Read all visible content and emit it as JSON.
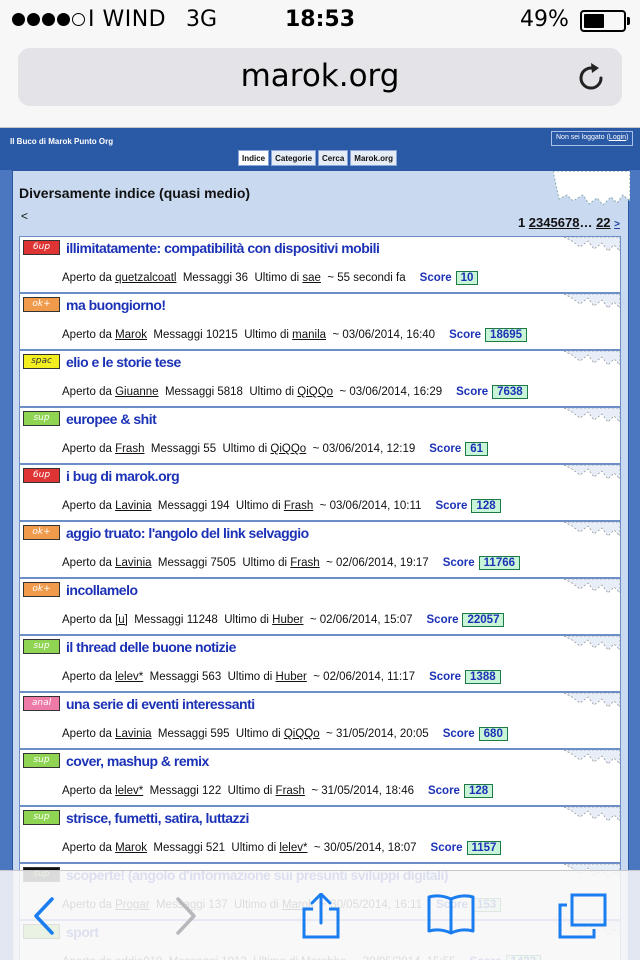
{
  "status": {
    "carrier": "I WIND",
    "network": "3G",
    "time": "18:53",
    "battery_pct": "49%",
    "battery_level": 0.49,
    "signal_bars_filled": 4,
    "signal_bars_total": 5
  },
  "browser": {
    "url": "marok.org"
  },
  "site": {
    "name": "Il Buco di Marok Punto Org",
    "login_prefix": "Non sei loggato (",
    "login_link": "Login",
    "login_suffix": ")",
    "tabs": [
      "Indice",
      "Categorie",
      "Cerca",
      "Marok.org"
    ]
  },
  "index": {
    "heading": "Diversamente indice (quasi medio)",
    "back": "<",
    "pager": {
      "current": "1",
      "pages": [
        "2",
        "3",
        "4",
        "5",
        "6",
        "7",
        "8"
      ],
      "ellipsis": "…",
      "last": "22",
      "next": ">"
    }
  },
  "labels": {
    "opened_by": "Aperto da",
    "messages": "Messaggi",
    "last_by": "Ultimo di",
    "score": "Score"
  },
  "threads": [
    {
      "badge": "6up",
      "badge_color": "red",
      "title": "illimitatamente: compatibilità con dispositivi mobili",
      "author": "quetzalcoatl",
      "messages": "36",
      "last_user": "sae",
      "when": "~ 55 secondi fa",
      "score": "10"
    },
    {
      "badge": "ok+",
      "badge_color": "orange",
      "title": "ma buongiorno!",
      "author": "Marok",
      "messages": "10215",
      "last_user": "manila",
      "when": "~ 03/06/2014, 16:40",
      "score": "18695"
    },
    {
      "badge": "spac",
      "badge_color": "yellow",
      "title": "elio e le storie tese",
      "author": "Giuanne",
      "messages": "5818",
      "last_user": "QiQQo",
      "when": "~ 03/06/2014, 16:29",
      "score": "7638"
    },
    {
      "badge": "sup",
      "badge_color": "green",
      "title": "europee & shit",
      "author": "Frash",
      "messages": "55",
      "last_user": "QiQQo",
      "when": "~ 03/06/2014, 12:19",
      "score": "61"
    },
    {
      "badge": "6up",
      "badge_color": "red",
      "title": "i bug di marok.org",
      "author": "Lavinia",
      "messages": "194",
      "last_user": "Frash",
      "when": "~ 03/06/2014, 10:11",
      "score": "128"
    },
    {
      "badge": "ok+",
      "badge_color": "orange",
      "title": "aggio truato: l'angolo del link selvaggio",
      "author": "Lavinia",
      "messages": "7505",
      "last_user": "Frash",
      "when": "~ 02/06/2014, 19:17",
      "score": "11766"
    },
    {
      "badge": "ok+",
      "badge_color": "orange",
      "title": "incollamelo",
      "author": "[u]",
      "messages": "11248",
      "last_user": "Huber",
      "when": "~ 02/06/2014, 15:07",
      "score": "22057"
    },
    {
      "badge": "sup",
      "badge_color": "green",
      "title": "il thread delle buone notizie",
      "author": "lelev*",
      "messages": "563",
      "last_user": "Huber",
      "when": "~ 02/06/2014, 11:17",
      "score": "1388"
    },
    {
      "badge": "anal",
      "badge_color": "pink",
      "title": "una serie di eventi interessanti",
      "author": "Lavinia",
      "messages": "595",
      "last_user": "QiQQo",
      "when": "~ 31/05/2014, 20:05",
      "score": "680"
    },
    {
      "badge": "sup",
      "badge_color": "green",
      "title": "cover, mashup & remix",
      "author": "lelev*",
      "messages": "122",
      "last_user": "Frash",
      "when": "~ 31/05/2014, 18:46",
      "score": "128"
    },
    {
      "badge": "sup",
      "badge_color": "green",
      "title": "strisce, fumetti, satira, luttazzi",
      "author": "Marok",
      "messages": "521",
      "last_user": "lelev*",
      "when": "~ 30/05/2014, 18:07",
      "score": "1157"
    },
    {
      "badge": "sup",
      "badge_color": "black",
      "title": "scoperte! (angolo d'informazione sui presunti sviluppi digitali)",
      "author": "Progar",
      "messages": "137",
      "last_user": "Marok",
      "when": "~ 30/05/2014, 16:11",
      "score": "153"
    },
    {
      "badge": "",
      "badge_color": "green",
      "title": "sport",
      "author": "eddie019",
      "messages": "1012",
      "last_user": "Marobbe",
      "when": "~ 30/05/2014, 15:55",
      "score": "1432"
    }
  ],
  "toolbar": {
    "icons": [
      "back-icon",
      "forward-icon",
      "share-icon",
      "bookmarks-icon",
      "tabs-icon"
    ]
  }
}
